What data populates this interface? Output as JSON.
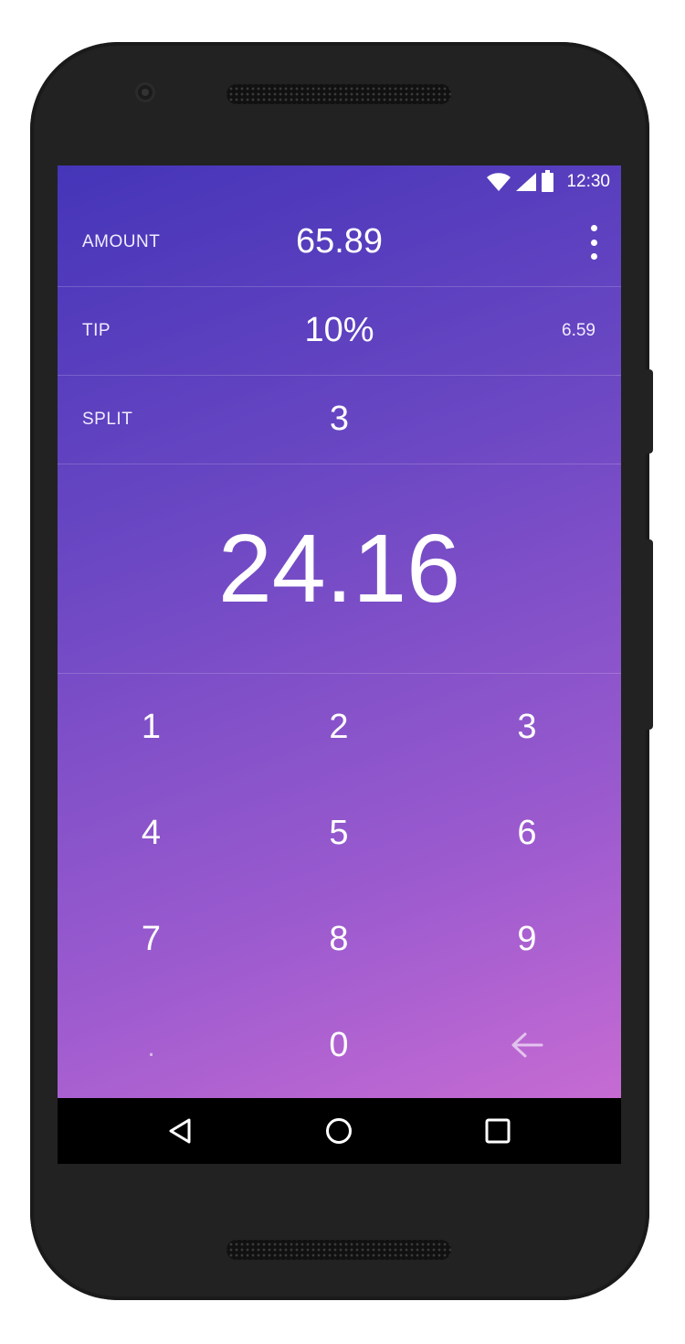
{
  "status_bar": {
    "time": "12:30",
    "icons": [
      "wifi-icon",
      "signal-icon",
      "battery-icon"
    ]
  },
  "inputs": {
    "amount": {
      "label": "AMOUNT",
      "value": "65.89"
    },
    "tip": {
      "label": "TIP",
      "value": "10%",
      "computed": "6.59"
    },
    "split": {
      "label": "SPLIT",
      "value": "3"
    }
  },
  "result": "24.16",
  "keypad": {
    "keys": [
      "1",
      "2",
      "3",
      "4",
      "5",
      "6",
      "7",
      "8",
      "9",
      ".",
      "0"
    ],
    "backspace_icon": "backspace-arrow-icon"
  },
  "nav_bar": {
    "back_icon": "back-triangle-icon",
    "home_icon": "home-circle-icon",
    "recents_icon": "recents-square-icon"
  },
  "theme": {
    "gradient_start": "#4535b8",
    "gradient_end": "#c66bd3",
    "device_color": "#222222"
  }
}
